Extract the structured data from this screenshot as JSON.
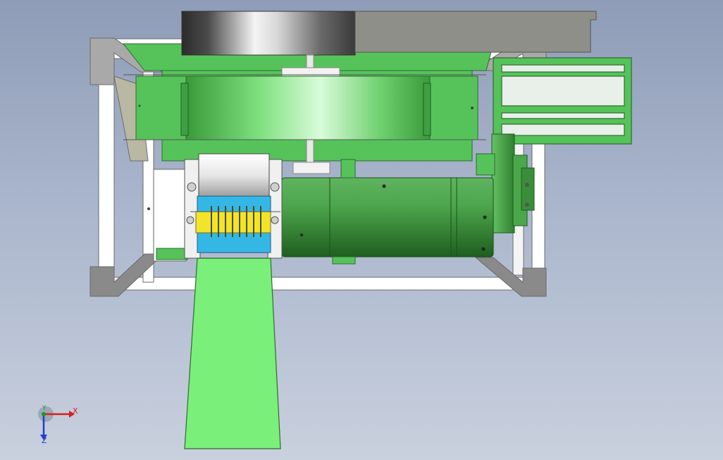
{
  "viewport": {
    "background_top": "#8e9cb7",
    "background_bottom": "#c9d0de"
  },
  "model": {
    "frame_color": "#ffffff",
    "frame_edge_color": "#6b6b6b",
    "part_green_color": "#55c35a",
    "part_light_green_color": "#7af07a",
    "motor_color": "#3f8f3f",
    "cutter_yellow_color": "#f2e42a",
    "cutter_blue_color": "#35b7e6",
    "flywheel_color": "#8b8b8b"
  },
  "triad": {
    "x_label": "X",
    "y_label": "Y",
    "z_label": "Z",
    "x_color": "#d81e1e",
    "y_color": "#1a9a1a",
    "z_color": "#1f3fd0"
  }
}
